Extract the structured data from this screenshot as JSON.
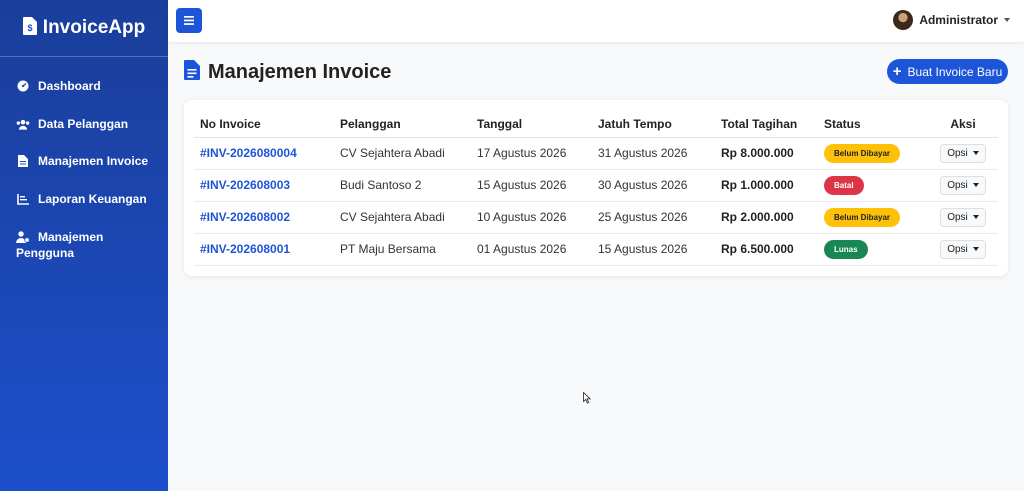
{
  "brand": {
    "name": "InvoiceApp",
    "icon": "file-invoice-dollar-icon"
  },
  "sidebar": {
    "items": [
      {
        "label": "Dashboard",
        "icon": "gauge-icon"
      },
      {
        "label": "Data Pelanggan",
        "icon": "users-icon"
      },
      {
        "label": "Manajemen Invoice",
        "icon": "file-invoice-icon"
      },
      {
        "label": "Laporan Keuangan",
        "icon": "chart-line-icon"
      },
      {
        "label": "Manajemen Pengguna",
        "icon": "user-gear-icon"
      }
    ]
  },
  "topbar": {
    "user_name": "Administrator"
  },
  "page": {
    "title": "Manajemen Invoice",
    "new_button": "Buat Invoice Baru"
  },
  "table": {
    "headers": [
      "No Invoice",
      "Pelanggan",
      "Tanggal",
      "Jatuh Tempo",
      "Total Tagihan",
      "Status",
      "Aksi"
    ],
    "rows": [
      {
        "invoice": "#INV-2026080004",
        "customer": "CV Sejahtera Abadi",
        "date": "17 Agustus 2026",
        "due": "31 Agustus 2026",
        "total": "Rp 8.000.000",
        "status": "Belum Dibayar",
        "action": "Opsi"
      },
      {
        "invoice": "#INV-202608003",
        "customer": "Budi Santoso 2",
        "date": "15 Agustus 2026",
        "due": "30 Agustus 2026",
        "total": "Rp 1.000.000",
        "status": "Batal",
        "action": "Opsi"
      },
      {
        "invoice": "#INV-202608002",
        "customer": "CV Sejahtera Abadi",
        "date": "10 Agustus 2026",
        "due": "25 Agustus 2026",
        "total": "Rp 2.000.000",
        "status": "Belum Dibayar",
        "action": "Opsi"
      },
      {
        "invoice": "#INV-202608001",
        "customer": "PT Maju Bersama",
        "date": "01 Agustus 2026",
        "due": "15 Agustus 2026",
        "total": "Rp 6.500.000",
        "status": "Lunas",
        "action": "Opsi"
      }
    ]
  },
  "colors": {
    "primary": "#1d55d9",
    "warning": "#ffc107",
    "danger": "#dc3545",
    "success": "#198754"
  }
}
